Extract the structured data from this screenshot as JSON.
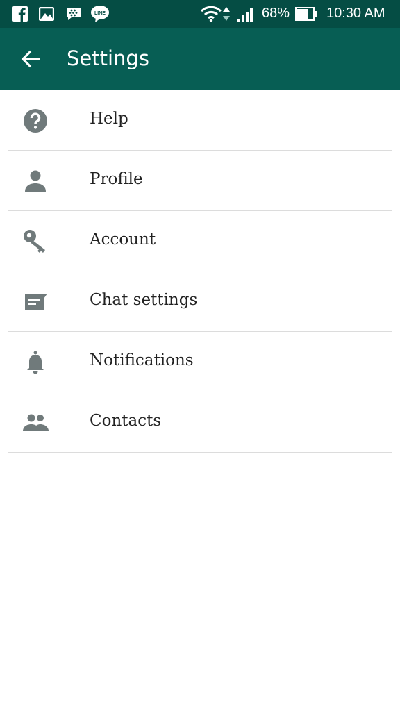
{
  "status_bar": {
    "battery_text": "68%",
    "time": "10:30 AM",
    "notification_icons": [
      "facebook-icon",
      "gallery-icon",
      "bbm-icon",
      "line-icon"
    ],
    "line_badge": "LINE"
  },
  "app_bar": {
    "title": "Settings",
    "back_icon": "arrow-left-icon"
  },
  "settings": {
    "items": [
      {
        "label": "Help",
        "icon": "help-icon"
      },
      {
        "label": "Profile",
        "icon": "person-icon"
      },
      {
        "label": "Account",
        "icon": "key-icon"
      },
      {
        "label": "Chat settings",
        "icon": "chat-icon"
      },
      {
        "label": "Notifications",
        "icon": "bell-icon"
      },
      {
        "label": "Contacts",
        "icon": "people-icon"
      }
    ]
  },
  "colors": {
    "status_bar": "#054d44",
    "app_bar": "#075e54",
    "icon": "#707a7b",
    "text": "#222222",
    "divider": "#dcdcdc"
  }
}
